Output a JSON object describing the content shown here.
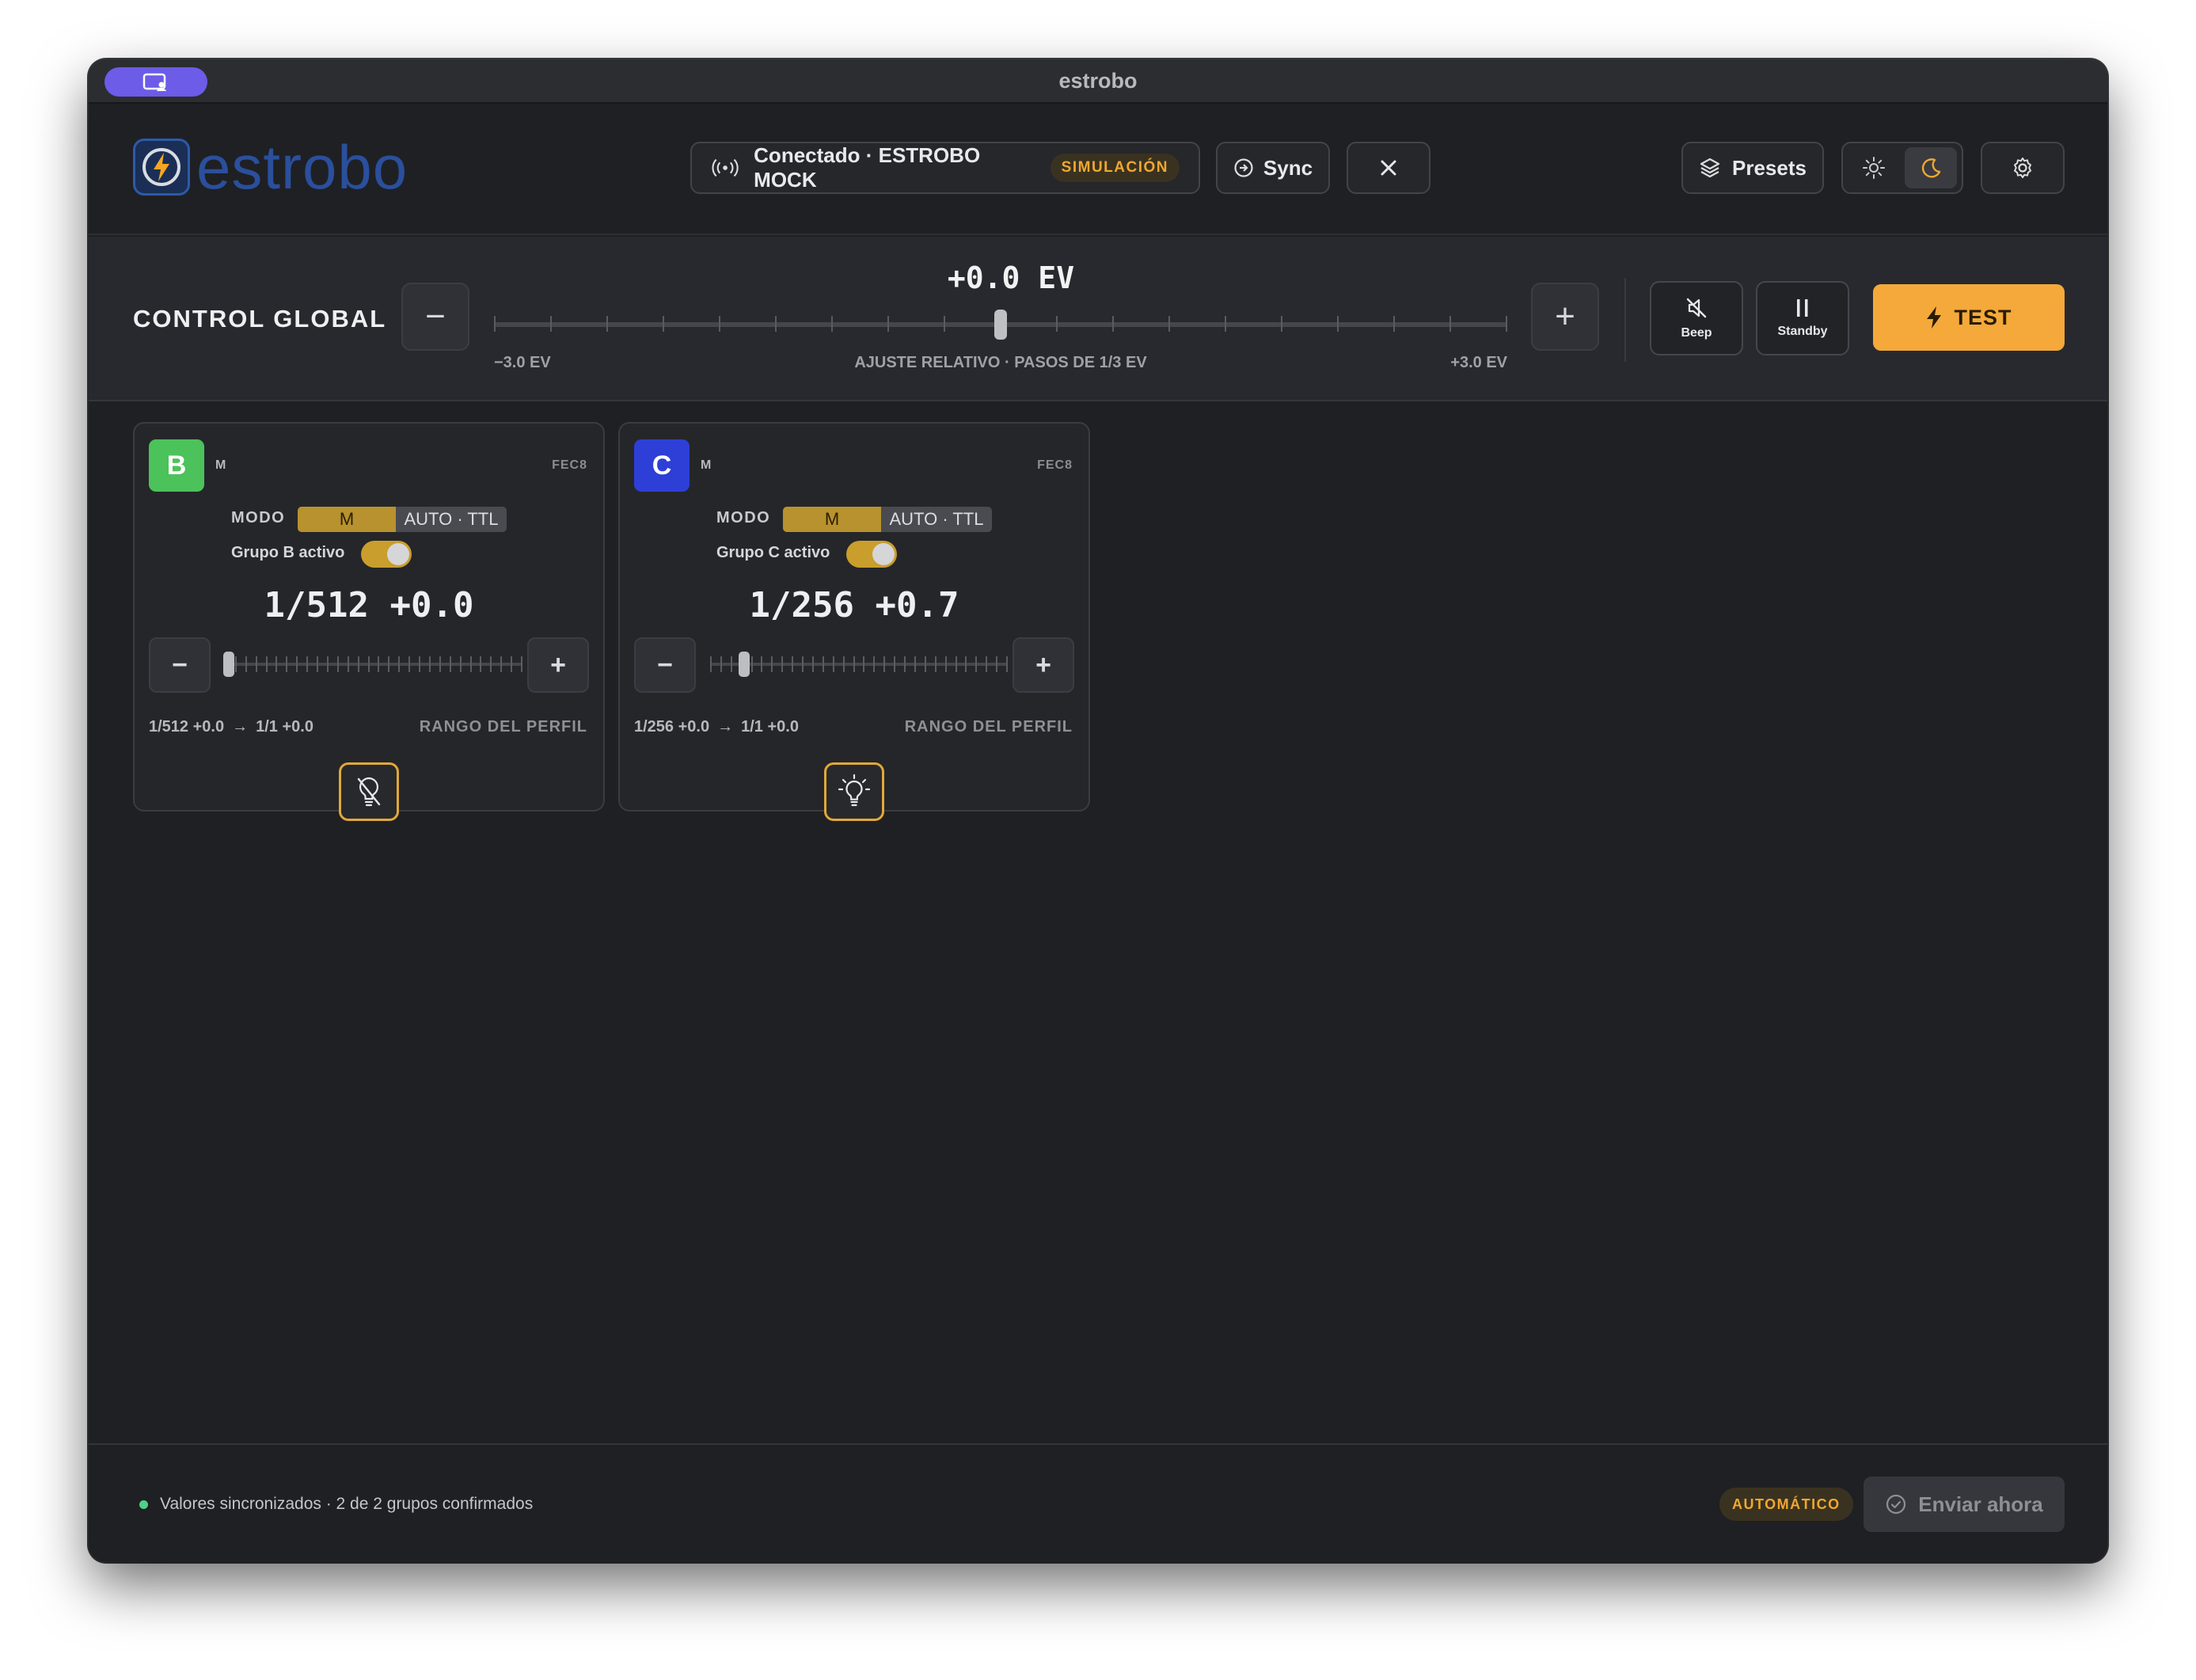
{
  "window": {
    "title": "estrobo"
  },
  "header": {
    "logo_text": "estrobo",
    "connection": {
      "label": "Conectado · ESTROBO MOCK",
      "badge": "SIMULACIÓN"
    },
    "sync_label": "Sync",
    "presets_label": "Presets",
    "theme_active": "dark"
  },
  "global": {
    "title": "CONTROL GLOBAL",
    "ev_value": "+0.0 EV",
    "min_label": "−3.0 EV",
    "center_label": "AJUSTE RELATIVO · PASOS DE 1/3 EV",
    "max_label": "+3.0 EV",
    "slider": {
      "min": -3.0,
      "max": 3.0,
      "value": 0.0
    },
    "minus_label": "−",
    "plus_label": "+",
    "beep_label": "Beep",
    "standby_label": "Standby",
    "test_label": "TEST"
  },
  "groups": [
    {
      "letter": "B",
      "color": "#4cc25a",
      "mode_short": "M",
      "code": "FEC8",
      "modo_label": "MODO",
      "mode_options": [
        "M",
        "AUTO · TTL"
      ],
      "active_label": "Grupo B activo",
      "active": true,
      "value": "1/512 +0.0",
      "slider_fraction": 0.0,
      "range_from": "1/512 +0.0",
      "range_to": "1/1 +0.0",
      "range_label": "RANGO DEL PERFIL",
      "lamp": "off",
      "minus": "−",
      "plus": "+"
    },
    {
      "letter": "C",
      "color": "#2d3fd6",
      "mode_short": "M",
      "code": "FEC8",
      "modo_label": "MODO",
      "mode_options": [
        "M",
        "AUTO · TTL"
      ],
      "active_label": "Grupo C activo",
      "active": true,
      "value": "1/256 +0.7",
      "slider_fraction": 0.1,
      "range_from": "1/256 +0.0",
      "range_to": "1/1 +0.0",
      "range_label": "RANGO DEL PERFIL",
      "lamp": "on",
      "minus": "−",
      "plus": "+"
    }
  ],
  "footer": {
    "status": "Valores sincronizados · 2 de 2 grupos confirmados",
    "mode_badge": "AUTOMÁTICO",
    "send_label": "Enviar ahora"
  },
  "colors": {
    "accent": "#f4a93a",
    "group_b": "#4cc25a",
    "group_c": "#2d3fd6",
    "status_ok": "#4fd08a"
  }
}
